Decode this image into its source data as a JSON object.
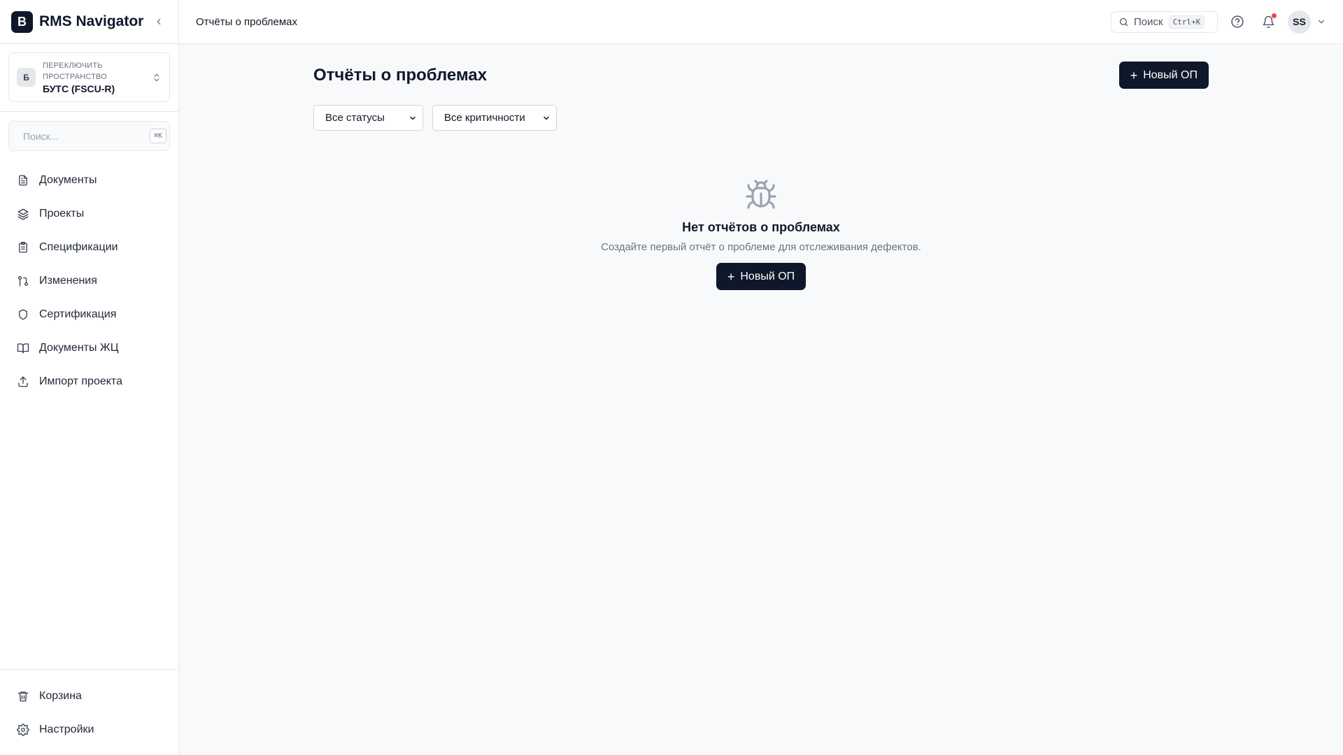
{
  "app": {
    "logo_letter": "B",
    "name": "RMS Navigator"
  },
  "workspace": {
    "caption": "Переключить пространство",
    "avatar_letter": "Б",
    "name": "БУТС (FSCU-R)"
  },
  "sidebar_search": {
    "placeholder": "Поиск...",
    "shortcut": "⌘K"
  },
  "nav": [
    {
      "label": "Документы",
      "icon": "file-icon"
    },
    {
      "label": "Проекты",
      "icon": "layers-icon"
    },
    {
      "label": "Спецификации",
      "icon": "clipboard-icon"
    },
    {
      "label": "Изменения",
      "icon": "git-pull-request-icon"
    },
    {
      "label": "Сертификация",
      "icon": "shield-icon"
    },
    {
      "label": "Документы ЖЦ",
      "icon": "book-open-icon"
    },
    {
      "label": "Импорт проекта",
      "icon": "upload-icon"
    }
  ],
  "nav_bottom": [
    {
      "label": "Корзина",
      "icon": "trash-icon"
    },
    {
      "label": "Настройки",
      "icon": "gear-icon"
    }
  ],
  "header": {
    "breadcrumb": "Отчёты о проблемах",
    "search_label": "Поиск",
    "search_shortcut": "Ctrl+K",
    "user_initials": "SS"
  },
  "page": {
    "title": "Отчёты о проблемах",
    "new_button": "Новый ОП",
    "filters": {
      "status": "Все статусы",
      "severity": "Все критичности"
    },
    "empty": {
      "icon": "bug-icon",
      "title": "Нет отчётов о проблемах",
      "subtitle": "Создайте первый отчёт о проблеме для отслеживания дефектов.",
      "button": "Новый ОП"
    }
  },
  "colors": {
    "primary": "#0f172a",
    "notification": "#ef4444",
    "border": "#e5e7eb",
    "muted": "#6b7280"
  }
}
